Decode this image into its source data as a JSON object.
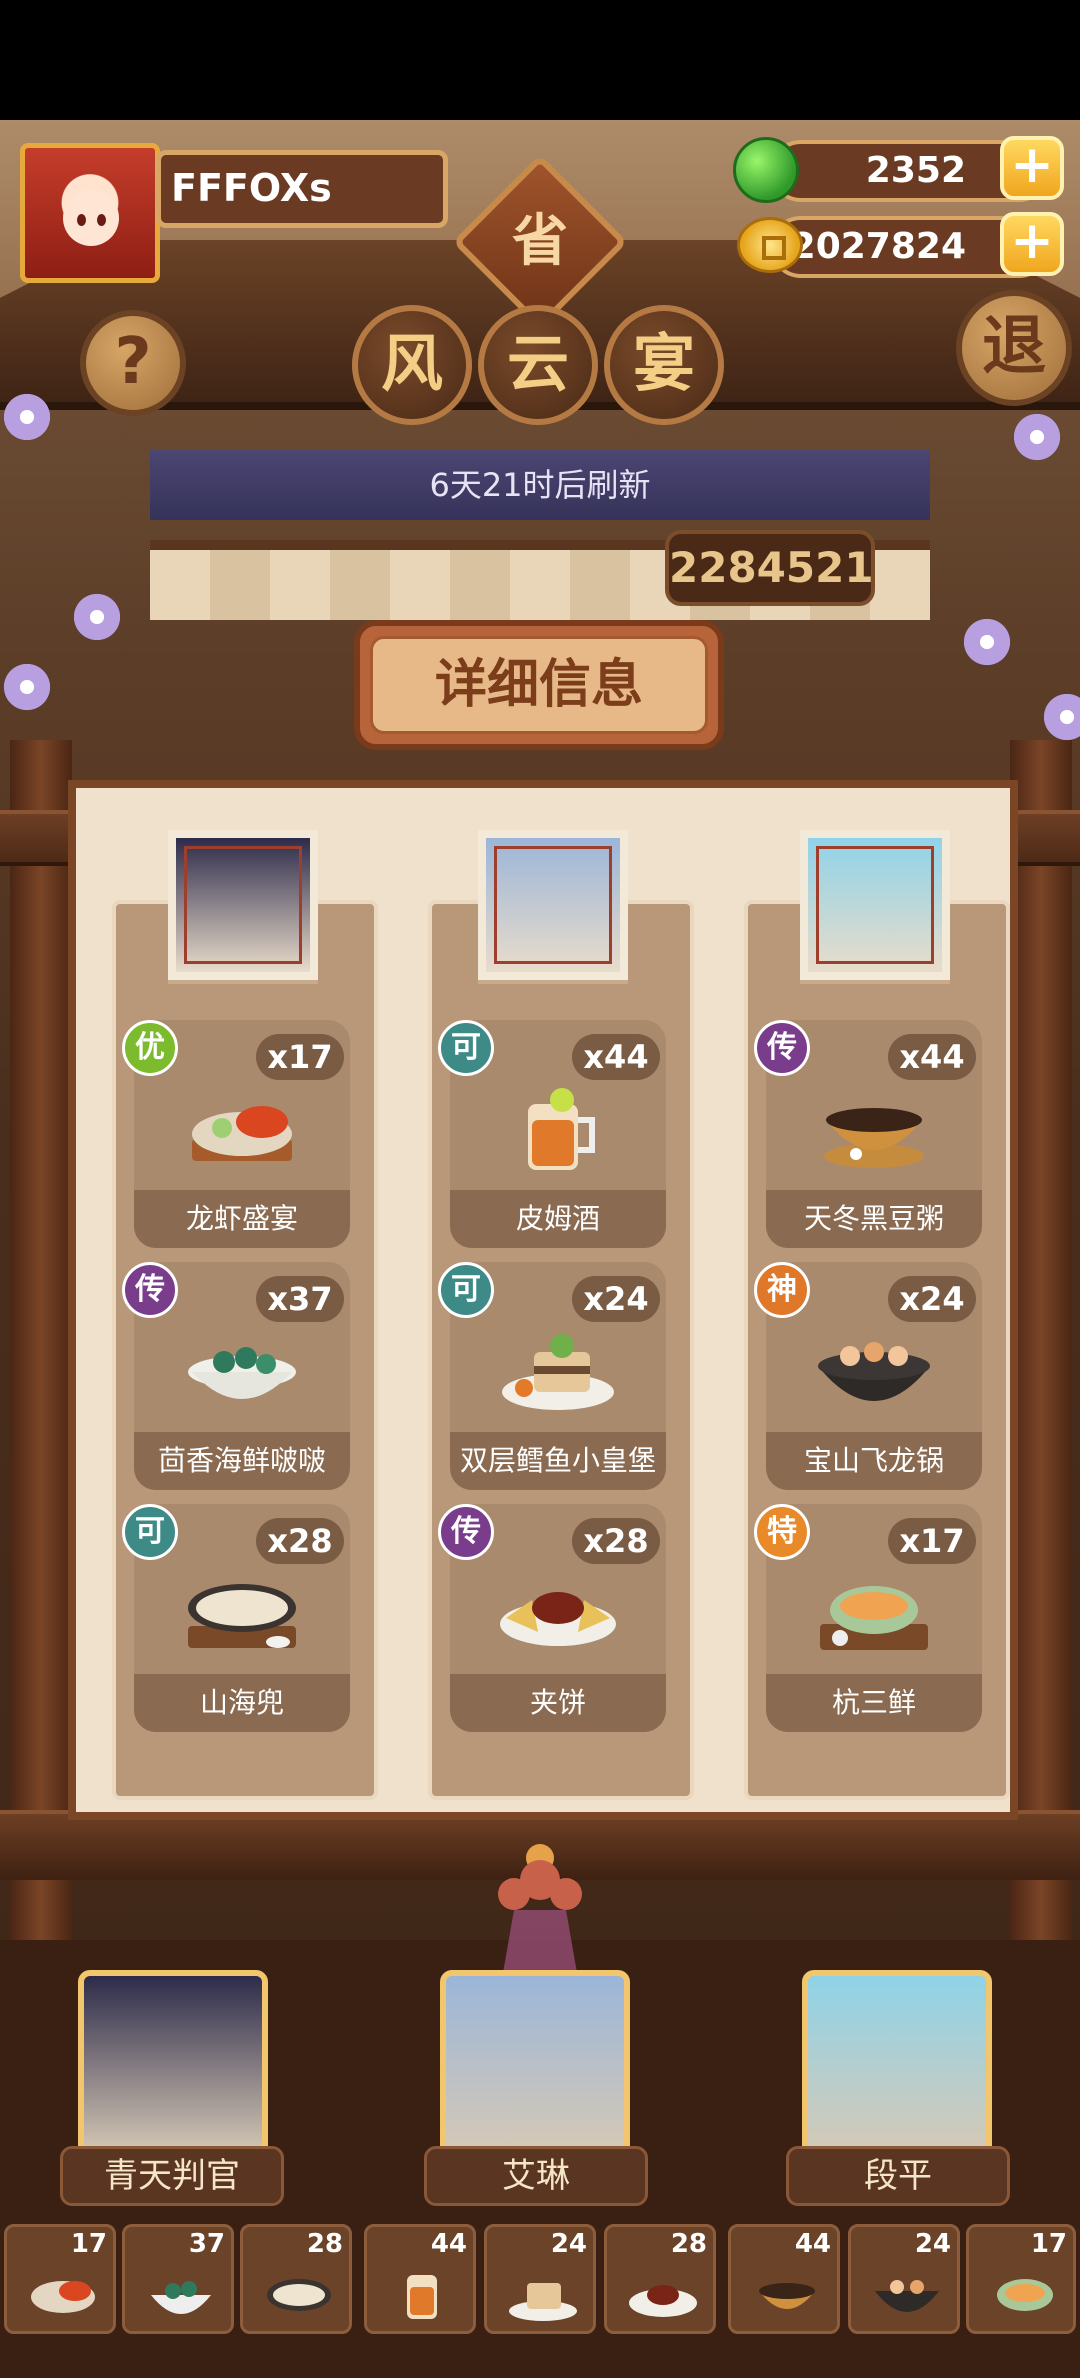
{
  "player": {
    "name": "FFFOXs"
  },
  "header": {
    "province_badge": "省",
    "help_icon": "?",
    "exit_label": "退"
  },
  "currency": {
    "apples": "2352",
    "coins": "2027824",
    "plus": "+"
  },
  "event": {
    "title_chars": [
      "风",
      "云",
      "宴"
    ],
    "refresh_text": "6天21时后刷新",
    "score": "2284521",
    "details_title": "详细信息"
  },
  "colors": {
    "grade_you": "#7dbb2e",
    "grade_ke": "#3d8a86",
    "grade_chuan": "#7a3d8c",
    "grade_shen": "#e0782a",
    "grade_te": "#e98a2a"
  },
  "columns": [
    {
      "character": "青天判官",
      "dishes": [
        {
          "grade": "优",
          "grade_color": "#7dbb2e",
          "count": "x17",
          "name": "龙虾盛宴"
        },
        {
          "grade": "传",
          "grade_color": "#7a3d8c",
          "count": "x37",
          "name": "茴香海鲜啵啵"
        },
        {
          "grade": "可",
          "grade_color": "#3d8a86",
          "count": "x28",
          "name": "山海兜"
        }
      ]
    },
    {
      "character": "艾琳",
      "dishes": [
        {
          "grade": "可",
          "grade_color": "#3d8a86",
          "count": "x44",
          "name": "皮姆酒"
        },
        {
          "grade": "可",
          "grade_color": "#3d8a86",
          "count": "x24",
          "name": "双层鳕鱼小皇堡"
        },
        {
          "grade": "传",
          "grade_color": "#7a3d8c",
          "count": "x28",
          "name": "夹饼"
        }
      ]
    },
    {
      "character": "段平",
      "dishes": [
        {
          "grade": "传",
          "grade_color": "#7a3d8c",
          "count": "x44",
          "name": "天冬黑豆粥"
        },
        {
          "grade": "神",
          "grade_color": "#e0782a",
          "count": "x24",
          "name": "宝山飞龙锅"
        },
        {
          "grade": "特",
          "grade_color": "#e98a2a",
          "count": "x17",
          "name": "杭三鲜"
        }
      ]
    }
  ],
  "bottom_characters": [
    "青天判官",
    "艾琳",
    "段平"
  ],
  "inventory": [
    "17",
    "37",
    "28",
    "44",
    "24",
    "28",
    "44",
    "24",
    "17"
  ]
}
